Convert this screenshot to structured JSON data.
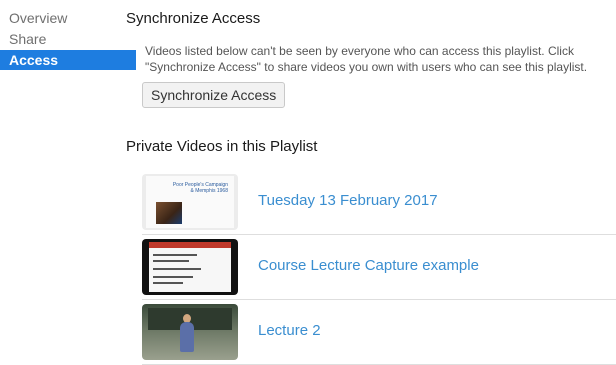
{
  "sidebar": {
    "items": [
      {
        "label": "Overview"
      },
      {
        "label": "Share"
      },
      {
        "label": "Access"
      }
    ]
  },
  "sync": {
    "title": "Synchronize Access",
    "description": "Videos listed below can't be seen by everyone who can access this playlist. Click \"Synchronize Access\" to share videos you own with users who can see this playlist.",
    "button_label": "Synchronize Access"
  },
  "private_videos": {
    "title": "Private Videos in this Playlist",
    "items": [
      {
        "title": "Tuesday 13 February 2017",
        "thumb_text": "Poor People's Campaign & Memphis 1968"
      },
      {
        "title": "Course Lecture Capture example"
      },
      {
        "title": "Lecture 2"
      }
    ]
  },
  "colors": {
    "accent": "#1e7de0",
    "link": "#3a8ed0"
  }
}
